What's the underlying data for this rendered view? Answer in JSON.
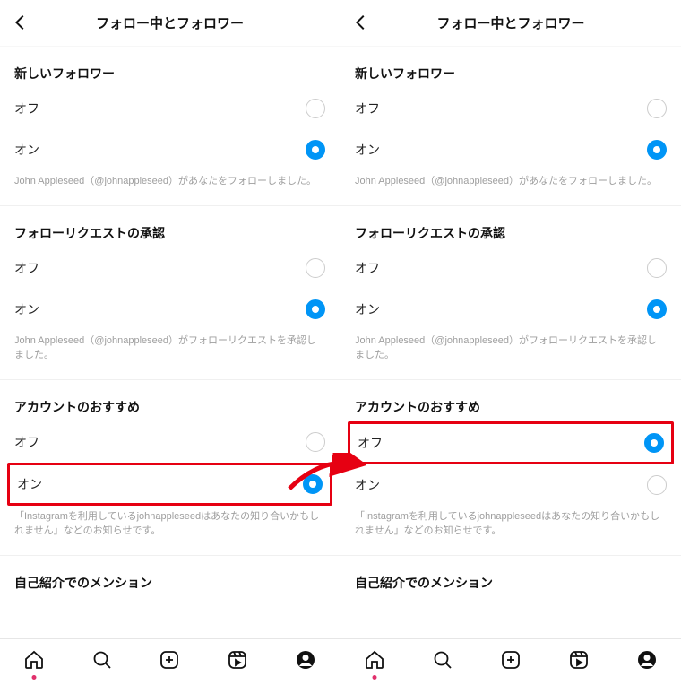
{
  "header": {
    "title": "フォロー中とフォロワー"
  },
  "sections": {
    "newFollowers": {
      "title": "新しいフォロワー",
      "off": "オフ",
      "on": "オン",
      "hint": "John Appleseed（@johnappleseed）があなたをフォローしました。"
    },
    "followRequestAccepted": {
      "title": "フォローリクエストの承認",
      "off": "オフ",
      "on": "オン",
      "hint": "John Appleseed（@johnappleseed）がフォローリクエストを承認しました。"
    },
    "accountSuggestions": {
      "title": "アカウントのおすすめ",
      "off": "オフ",
      "on": "オン",
      "hint": "「Instagramを利用しているjohnappleseedはあなたの知り合いかもしれません」などのお知らせです。"
    },
    "bioMentions": {
      "title": "自己紹介でのメンション"
    }
  },
  "leftPane": {
    "newFollowers": "on",
    "followRequestAccepted": "on",
    "accountSuggestions": "on"
  },
  "rightPane": {
    "newFollowers": "on",
    "followRequestAccepted": "on",
    "accountSuggestions": "off"
  },
  "colors": {
    "accent": "#0095f6",
    "highlight": "#e60012"
  }
}
